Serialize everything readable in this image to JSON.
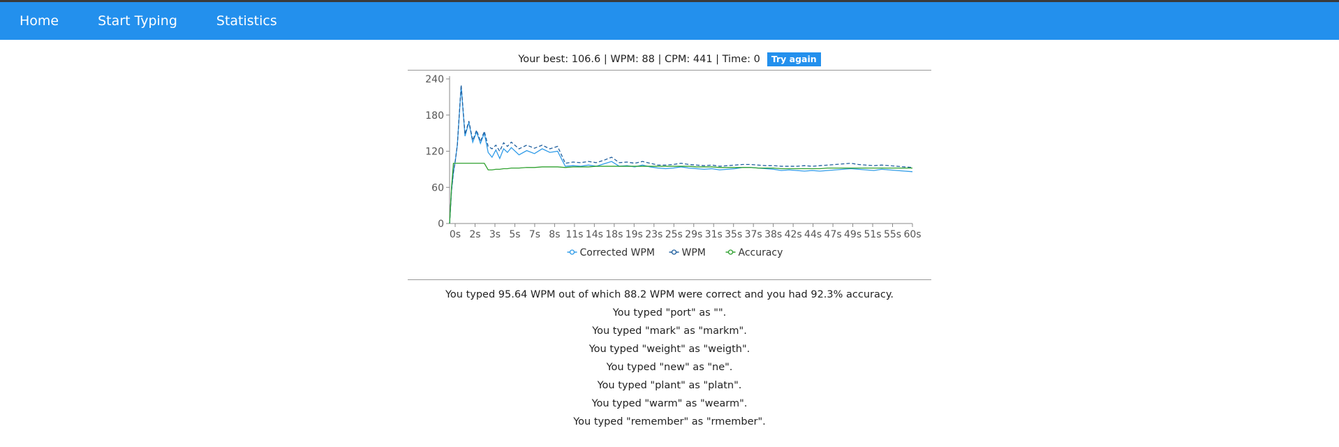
{
  "nav": {
    "home": "Home",
    "start_typing": "Start Typing",
    "statistics": "Statistics"
  },
  "summary": {
    "text": "Your best: 106.6 | WPM: 88 | CPM: 441 | Time: 0",
    "try_again": "Try again"
  },
  "colors": {
    "nav_bg": "#2390ed",
    "corrected_wpm": "#2f9be8",
    "wpm": "#1f5f9e",
    "accuracy": "#2fa12f"
  },
  "chart_data": {
    "type": "line",
    "title": "",
    "xlabel": "",
    "ylabel": "",
    "ylim": [
      0,
      240
    ],
    "yticks": [
      "0",
      "60",
      "120",
      "180",
      "240"
    ],
    "xticks": [
      "0s",
      "2s",
      "3s",
      "5s",
      "7s",
      "8s",
      "11s",
      "14s",
      "18s",
      "19s",
      "23s",
      "25s",
      "29s",
      "31s",
      "35s",
      "37s",
      "38s",
      "42s",
      "44s",
      "47s",
      "49s",
      "51s",
      "55s",
      "60s"
    ],
    "grid": false,
    "legend_position": "bottom",
    "x": [
      0,
      0.25,
      0.5,
      0.75,
      1,
      1.5,
      2,
      2.5,
      3,
      3.5,
      4,
      4.5,
      5,
      5.5,
      6,
      6.5,
      7,
      7.5,
      8,
      9,
      10,
      11,
      12,
      13,
      14,
      15,
      16,
      17,
      18,
      19,
      20,
      21,
      22,
      23,
      24,
      25,
      26,
      27,
      28,
      29,
      30,
      31,
      32,
      33,
      34,
      35,
      36,
      37,
      38,
      39,
      40,
      41,
      42,
      43,
      44,
      45,
      46,
      47,
      48,
      49,
      50,
      51,
      52,
      53,
      54,
      55,
      56,
      57,
      58,
      59,
      60
    ],
    "series": [
      {
        "name": "Corrected WPM",
        "values": [
          0,
          55,
          85,
          105,
          130,
          228,
          145,
          168,
          135,
          152,
          133,
          150,
          118,
          110,
          122,
          108,
          124,
          118,
          126,
          114,
          121,
          116,
          124,
          118,
          120,
          95,
          96,
          95,
          97,
          95,
          99,
          103,
          95,
          96,
          94,
          97,
          94,
          92,
          91,
          92,
          94,
          92,
          91,
          90,
          91,
          89,
          90,
          91,
          93,
          93,
          92,
          91,
          90,
          88,
          89,
          88,
          87,
          88,
          87,
          88,
          89,
          90,
          91,
          90,
          89,
          88,
          90,
          89,
          88,
          87,
          86
        ]
      },
      {
        "name": "WPM",
        "values": [
          0,
          55,
          85,
          105,
          130,
          230,
          148,
          170,
          138,
          155,
          136,
          153,
          128,
          124,
          130,
          120,
          134,
          128,
          135,
          124,
          130,
          125,
          130,
          124,
          128,
          100,
          102,
          101,
          103,
          101,
          105,
          110,
          101,
          102,
          100,
          103,
          100,
          97,
          97,
          98,
          100,
          98,
          97,
          96,
          97,
          95,
          96,
          97,
          98,
          98,
          97,
          96,
          96,
          95,
          95,
          95,
          96,
          95,
          96,
          97,
          98,
          99,
          100,
          98,
          97,
          96,
          97,
          96,
          95,
          94,
          93
        ]
      },
      {
        "name": "Accuracy",
        "values": [
          0,
          60,
          100,
          100,
          100,
          100,
          100,
          100,
          100,
          100,
          100,
          100,
          89,
          89,
          90,
          90,
          91,
          91,
          92,
          92,
          93,
          93,
          94,
          94,
          94,
          93,
          94,
          94,
          94,
          95,
          95,
          95,
          95,
          95,
          95,
          95,
          95,
          95,
          95,
          95,
          95,
          95,
          94,
          94,
          94,
          93,
          93,
          93,
          93,
          93,
          92,
          92,
          92,
          91,
          91,
          91,
          91,
          91,
          91,
          92,
          92,
          92,
          92,
          92,
          92,
          92,
          92,
          92,
          92,
          92,
          92
        ]
      }
    ]
  },
  "results": {
    "summary_line": "You typed 95.64 WPM out of which 88.2 WPM were correct and you had 92.3% accuracy.",
    "mistakes": [
      "You typed \"port\" as \"\".",
      "You typed \"mark\" as \"markm\".",
      "You typed \"weight\" as \"weigth\".",
      "You typed \"new\" as \"ne\".",
      "You typed \"plant\" as \"platn\".",
      "You typed \"warm\" as \"wearm\".",
      "You typed \"remember\" as \"rmember\"."
    ]
  }
}
